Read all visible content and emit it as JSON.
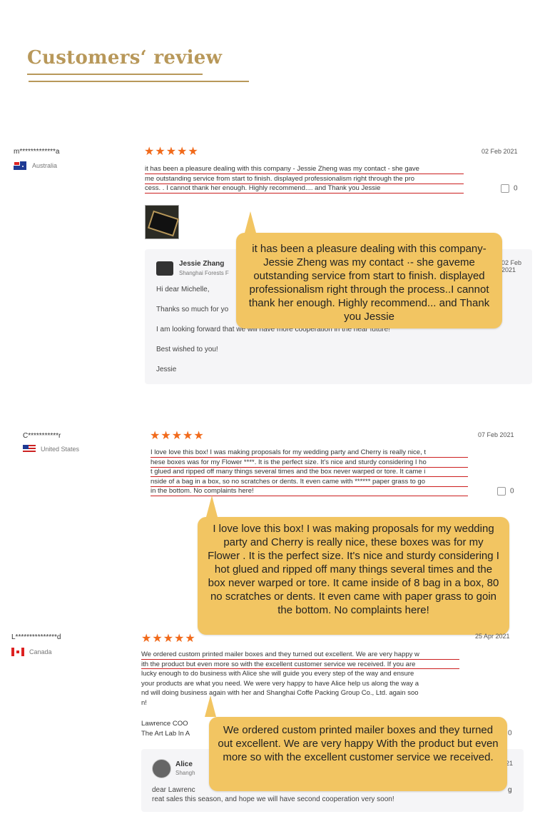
{
  "header": {
    "title": "Customers‘ review"
  },
  "reviews": [
    {
      "user": "m*************a",
      "country": "Australia",
      "stars": "★★★★★",
      "date": "02 Feb 2021",
      "text_lines": [
        "it has been a pleasure dealing with this company - Jessie Zheng was my contact - she gave",
        "me outstanding service from start to finish. displayed professionalism right through the pro",
        "cess. . I cannot thank her enough. Highly recommend.... and Thank you Jessie"
      ],
      "likes": "0",
      "reply": {
        "name": "Jessie Zhang",
        "company": "Shanghai Forests F",
        "date": "02 Feb 2021",
        "lines": [
          "Hi dear Michelle,",
          "Thanks so much for yo",
          "I am looking forward that we will have more cooperation in the near future!",
          "Best wished to you!",
          "Jessie"
        ]
      },
      "callout": "it has been a pleasure dealing with this company- Jessie Zheng was my contact ·- she gaveme outstanding service from start to finish. displayed professionalism right through the process..I cannot thank her enough. Highly recommend... and Thank you Jessie"
    },
    {
      "user": "C***********r",
      "country": "United States",
      "stars": "★★★★★",
      "date": "07 Feb 2021",
      "text_lines": [
        "I love love this box! I was making proposals for my wedding party and Cherry is really nice, t",
        "hese boxes was for my Flower ****. It is the perfect size. It's nice and sturdy considering I ho",
        "t glued and ripped off many things several times and the box never warped or tore. It came i",
        "nside of a bag in a box, so no scratches or dents. It even came with ****** paper grass to go",
        "in the bottom. No complaints here!"
      ],
      "likes": "0",
      "callout": "I love love this box! I was making proposals for my wedding party and Cherry is really nice, these boxes was for my Flower . It is the perfect size. It's nice and sturdy considering I hot glued and ripped off many things several times and the box never warped or tore. It came inside of 8 bag in a box, 80 no scratches or dents. It even came with paper grass to goin the bottom. No complaints here!"
    },
    {
      "user": "L***************d",
      "country": "Canada",
      "stars": "★★★★★",
      "date": "25 Apr 2021",
      "text_lines": [
        "We ordered custom printed mailer boxes and they turned out excellent. We are very happy w",
        "ith the product but even more so with the excellent customer service we received. If you are",
        "lucky enough to do business with Alice she will guide you every step of the way and ensure",
        "your products are what you need. We were very happy to have Alice help us along the way a",
        "nd will doing business again with her and Shanghai Coffe Packing Group Co., Ltd. again soo",
        "n!"
      ],
      "signature": [
        "Lawrence COO",
        "The Art Lab In A"
      ],
      "likes": "0",
      "reply": {
        "name": "Alice",
        "company": "Shangh",
        "date": "21",
        "lines": [
          "dear Lawrenc",
          "g",
          "reat sales this season, and hope we will have second cooperation very soon!"
        ]
      },
      "callout": "We ordered custom printed mailer boxes and they turned out excellent. We are very happy With the product but even more so with the excellent customer service we received."
    }
  ]
}
